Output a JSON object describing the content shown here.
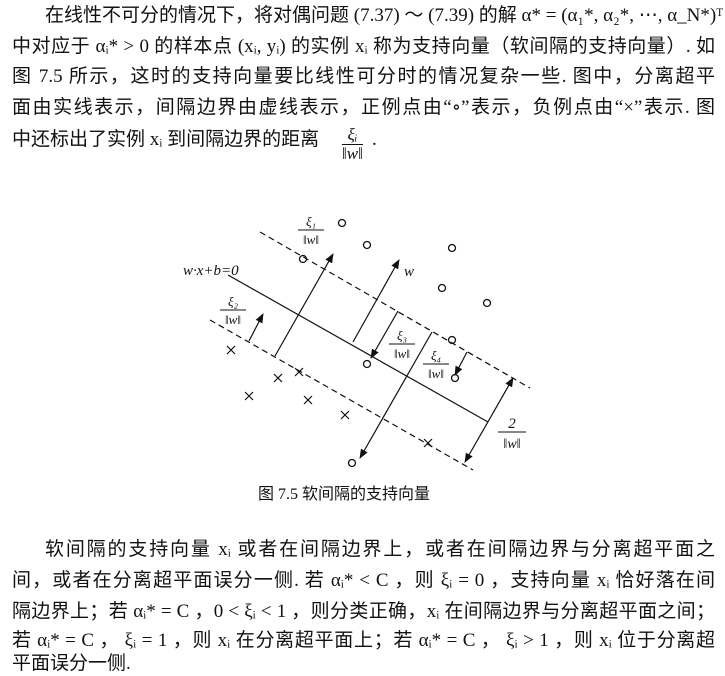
{
  "paragraph1": {
    "lines": [
      "在线性不可分的情况下，将对偶问题 (7.37) ～ (7.39) 的解 α* = (α₁*, α₂*, ⋯, α_N*)ᵀ",
      "中对应于 αᵢ* > 0 的样本点 (xᵢ, yᵢ) 的实例 xᵢ 称为支持向量（软间隔的支持向量）. 如",
      "图 7.5 所示，这时的支持向量要比线性可分时的情况复杂一些. 图中，分离超平",
      "面由实线表示，间隔边界由虚线表示，正例点由“∘”表示，负例点由“×”表示. 图",
      "中还标出了实例 xᵢ 到间隔边界的距离"
    ],
    "fraction_num": "ξᵢ",
    "fraction_den": "‖w‖",
    "end": "."
  },
  "figure": {
    "hyperplane_label": "w·x+b=0",
    "w_label": "w",
    "xi1": {
      "num": "ξ₁",
      "den": "‖w‖"
    },
    "xi2": {
      "num": "ξ₂",
      "den": "‖w‖"
    },
    "xi3": {
      "num": "ξ₃",
      "den": "‖w‖"
    },
    "xi4": {
      "num": "ξ₄",
      "den": "‖w‖"
    },
    "margin": {
      "num": "2",
      "den": "‖w‖"
    },
    "caption": "图 7.5    软间隔的支持向量"
  },
  "paragraph2": {
    "lines": [
      "软间隔的支持向量 xᵢ 或者在间隔边界上，或者在间隔边界与分离超平面之",
      "间，或者在分离超平面误分一侧. 若 αᵢ* < C ，则 ξᵢ = 0 ，支持向量 xᵢ 恰好落在间",
      "隔边界上；若 αᵢ* = C ，0 < ξᵢ < 1 ，则分类正确，xᵢ 在间隔边界与分离超平面之间；",
      "若 αᵢ* = C ， ξᵢ = 1 ，则 xᵢ 在分离超平面上；若 αᵢ* = C ， ξᵢ > 1 ，则 xᵢ 位于分离超",
      "平面误分一侧."
    ]
  }
}
